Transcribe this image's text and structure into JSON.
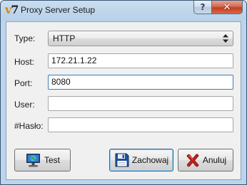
{
  "window": {
    "title": "Proxy Server Setup",
    "icon_text": {
      "v": "v",
      "n": "7"
    },
    "caption": {
      "help": "?",
      "close": "✕"
    }
  },
  "form": {
    "type": {
      "label": "Type:",
      "value": "HTTP"
    },
    "host": {
      "label": "Host:",
      "value": "172.21.1.22"
    },
    "port": {
      "label": "Port:",
      "value": "8080"
    },
    "user": {
      "label": "User:",
      "value": ""
    },
    "haslo": {
      "label": "#Hasło:",
      "value": ""
    }
  },
  "buttons": {
    "test": {
      "label": "Test",
      "icon": "monitor-globe-icon"
    },
    "save": {
      "label": "Zachowaj",
      "icon": "floppy-disk-icon"
    },
    "cancel": {
      "label": "Anuluj",
      "icon": "red-x-icon"
    }
  },
  "colors": {
    "window_frame": "#bcd5ee",
    "client_bg": "#f0f0f0",
    "focus_border": "#3d7bbf",
    "close_button": "#c7472a"
  }
}
